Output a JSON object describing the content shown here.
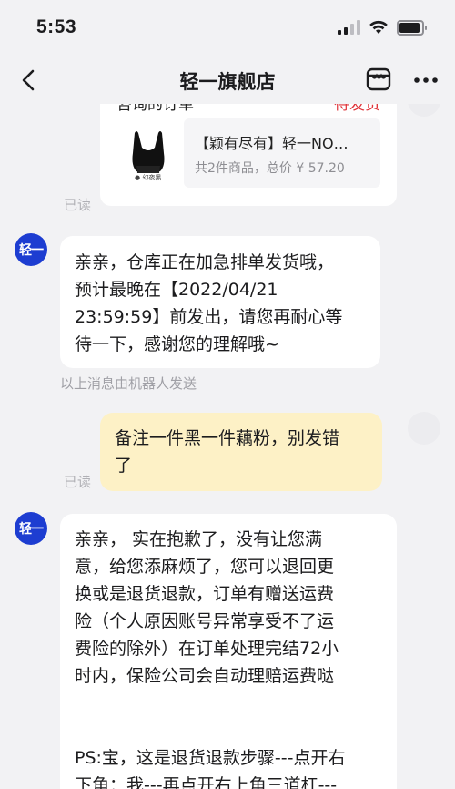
{
  "status_bar": {
    "time": "5:53"
  },
  "nav": {
    "title": "轻一旗舰店"
  },
  "order_card": {
    "header": "咨询的订单",
    "status": "待发货",
    "thumb_caption": "● 幻夜黑",
    "product_name": "【颖有尽有】轻一NO…",
    "summary": "共2件商品，总价 ¥ 57.20"
  },
  "messages": {
    "read_1": "已读",
    "bot_avatar": "轻一",
    "reply_1": {
      "lines": [
        "亲亲，仓库正在加急排单发货哦，",
        "预计最晚在【2022/04/21",
        "23:59:59】前发出，请您再耐心等",
        "待一下，感谢您的理解哦~"
      ]
    },
    "robot_note": "以上消息由机器人发送",
    "user_1": {
      "lines": [
        "备注一件黑一件藕粉，别发错",
        "了"
      ]
    },
    "read_2": "已读",
    "reply_2": {
      "lines": [
        "亲亲， 实在抱歉了，没有让您满",
        "意，给您添麻烦了，您可以退回更",
        "换或是退货退款，订单有赠送运费",
        "险（个人原因账号异常享受不了运",
        "费险的除外）在订单处理完结72小",
        "时内，保险公司会自动理赔运费哒"
      ],
      "ps_lines": [
        "PS:宝，这是退货退款步骤---点开右",
        "下角：我---再点开右上角三道杠---"
      ]
    }
  }
}
